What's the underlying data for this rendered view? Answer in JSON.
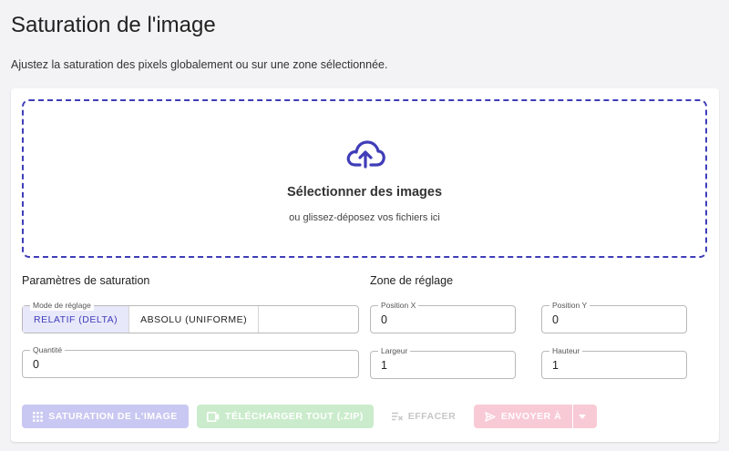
{
  "page": {
    "title": "Saturation de l'image",
    "description": "Ajustez la saturation des pixels globalement ou sur une zone sélectionnée."
  },
  "dropzone": {
    "icon": "cloud-upload-icon",
    "title": "Sélectionner des images",
    "subtitle": "ou glissez-déposez vos fichiers ici"
  },
  "saturation": {
    "section_title": "Paramètres de saturation",
    "mode_label": "Mode de réglage",
    "modes": [
      "RELATIF (DELTA)",
      "ABSOLU (UNIFORME)"
    ],
    "selected_mode": "RELATIF (DELTA)",
    "quantity_label": "Quantité",
    "quantity_value": "0"
  },
  "zone": {
    "section_title": "Zone de réglage",
    "x_label": "Position X",
    "x_value": "0",
    "y_label": "Position Y",
    "y_value": "0",
    "width_label": "Largeur",
    "width_value": "1",
    "height_label": "Hauteur",
    "height_value": "1"
  },
  "actions": {
    "saturate": "SATURATION DE L'IMAGE",
    "download_all": "TÉLÉCHARGER TOUT (.ZIP)",
    "clear": "EFFACER",
    "send_to": "ENVOYER À"
  },
  "colors": {
    "accent": "#3f3db8",
    "saturate_disabled": "#c9c8f2",
    "download_disabled": "#cbeccc",
    "send_disabled": "#f8cad6"
  }
}
